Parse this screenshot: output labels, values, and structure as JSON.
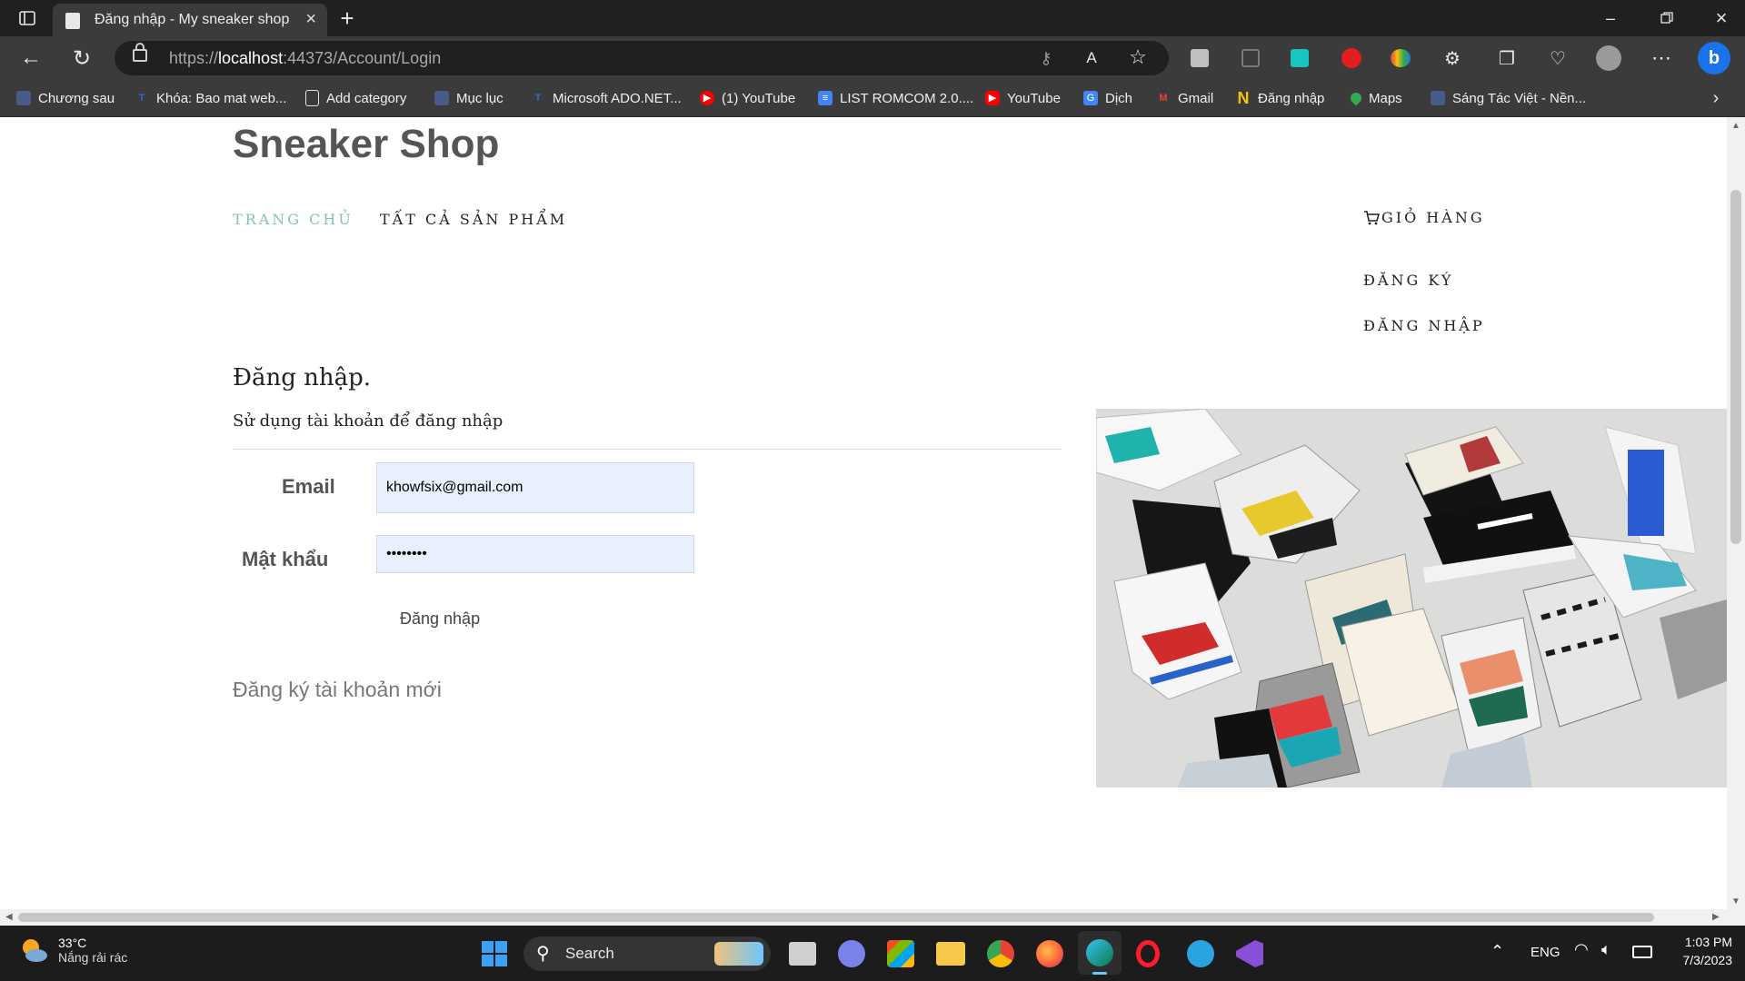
{
  "browser": {
    "tab_title": "Đăng nhập - My sneaker shop",
    "url_prefix": "https://",
    "url_host": "localhost",
    "url_rest": ":44373/Account/Login",
    "bookmarks": [
      {
        "label": "Chương sau",
        "icon": "page-icon",
        "color": "#4a5a8a"
      },
      {
        "label": "Khóa: Bao mat web...",
        "icon": "t-icon",
        "color": "#2a6ad8"
      },
      {
        "label": "Add category",
        "icon": "document-icon",
        "color": "#e0e0e0"
      },
      {
        "label": "Mục lục",
        "icon": "page-icon",
        "color": "#4a5a8a"
      },
      {
        "label": "Microsoft ADO.NET...",
        "icon": "t-icon",
        "color": "#2a6ad8"
      },
      {
        "label": "(1) YouTube",
        "icon": "youtube-icon",
        "color": "#ff0000"
      },
      {
        "label": "LIST ROMCOM 2.0....",
        "icon": "docs-icon",
        "color": "#4285f4"
      },
      {
        "label": "YouTube",
        "icon": "youtube-icon",
        "color": "#ff0000"
      },
      {
        "label": "Dịch",
        "icon": "translate-icon",
        "color": "#4285f4"
      },
      {
        "label": "Gmail",
        "icon": "gmail-icon",
        "color": "#ea4335"
      },
      {
        "label": "Đăng nhập",
        "icon": "n-icon",
        "color": "#f5c400"
      },
      {
        "label": "Maps",
        "icon": "maps-pin-icon",
        "color": "#34a853"
      },
      {
        "label": "Sáng Tác Việt - Nền...",
        "icon": "page-icon",
        "color": "#4a5a8a"
      }
    ]
  },
  "site": {
    "brand": "Sneaker Shop",
    "nav": {
      "home": "TRANG CHỦ",
      "all_products": "TẤT CẢ SẢN PHẨM",
      "cart": "GIỎ HÀNG",
      "register": "ĐĂNG KÝ",
      "login": "ĐĂNG NHẬP"
    }
  },
  "login": {
    "title": "Đăng nhập.",
    "subtitle": "Sử dụng tài khoản để đăng nhập",
    "email_label": "Email",
    "email_value": "khowfsix@gmail.com",
    "password_label": "Mật khẩu",
    "password_value": "••••••••",
    "submit_label": "Đăng nhập",
    "register_link": "Đăng ký tài khoản mới"
  },
  "taskbar": {
    "weather_temp": "33°C",
    "weather_desc": "Nắng rải rác",
    "search_label": "Search",
    "language": "ENG",
    "time": "1:03 PM",
    "date": "7/3/2023"
  }
}
